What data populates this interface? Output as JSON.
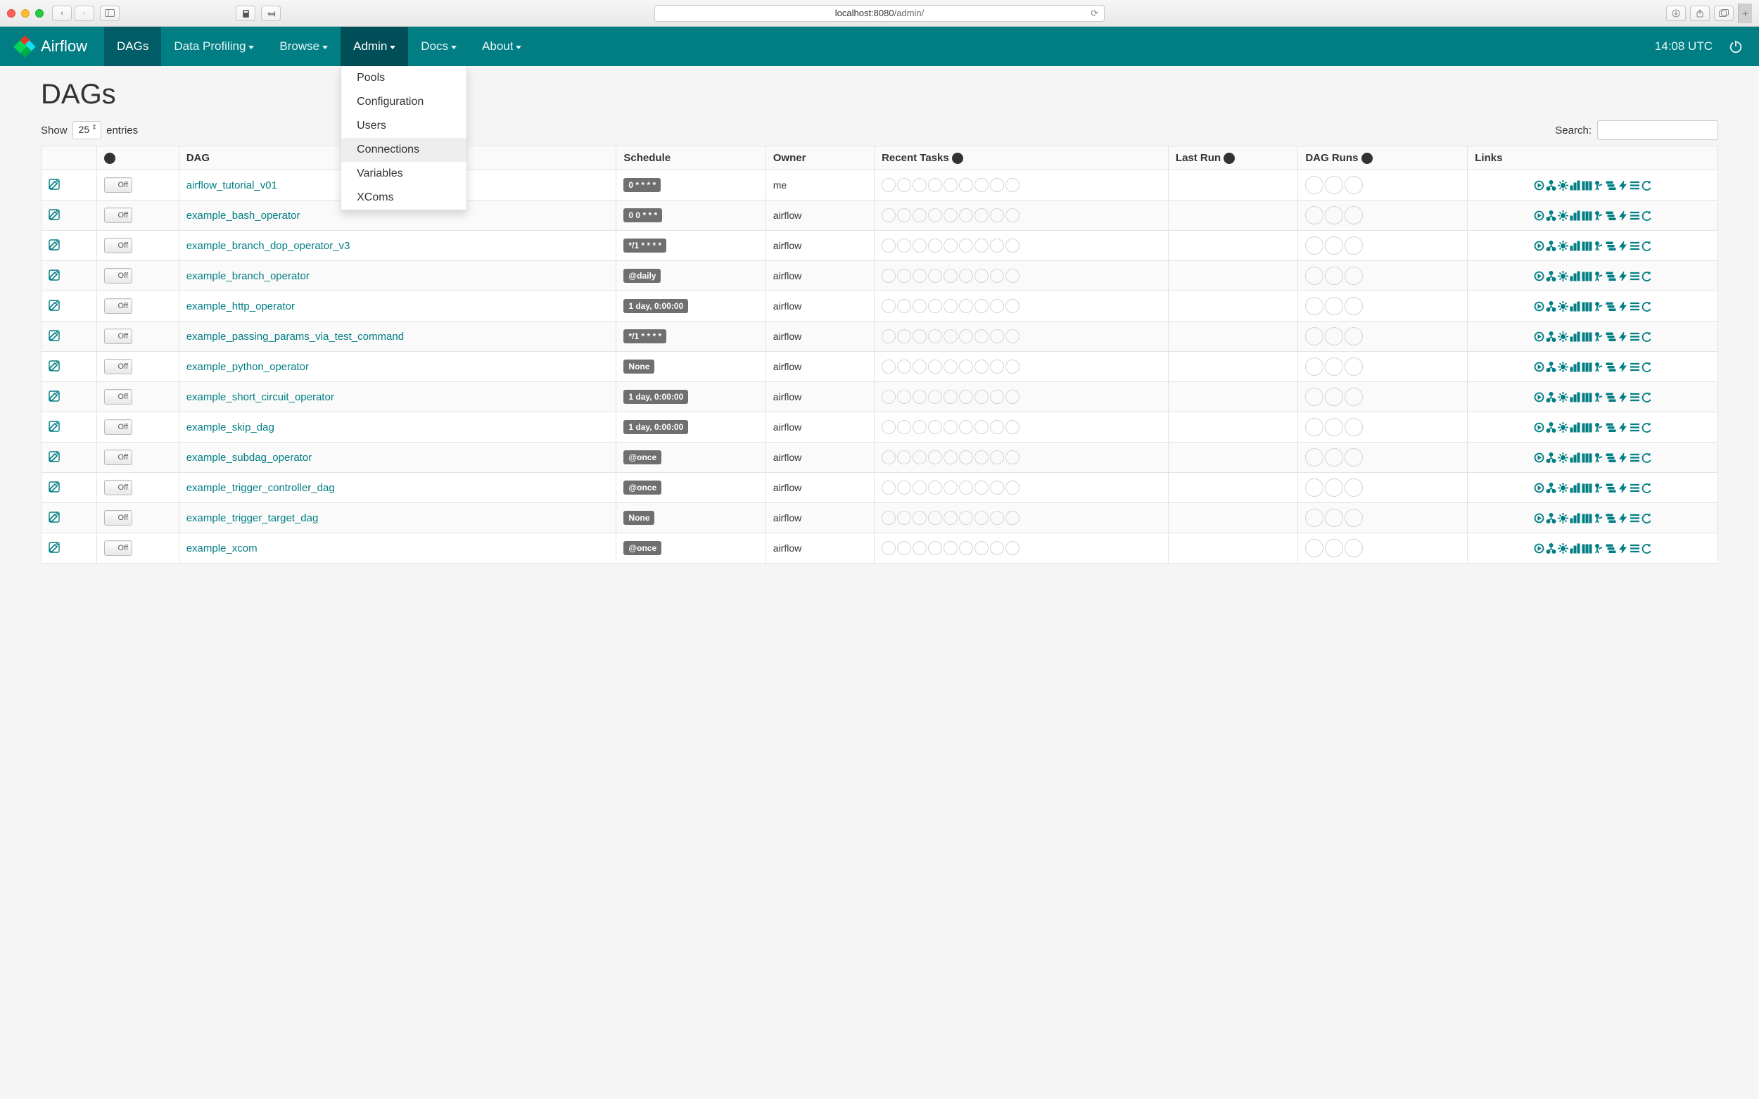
{
  "browser": {
    "url_host": "localhost:8080",
    "url_path": "/admin/"
  },
  "navbar": {
    "brand": "Airflow",
    "items": [
      {
        "label": "DAGs",
        "active": true
      },
      {
        "label": "Data Profiling",
        "dropdown": true
      },
      {
        "label": "Browse",
        "dropdown": true
      },
      {
        "label": "Admin",
        "dropdown": true,
        "open": true
      },
      {
        "label": "Docs",
        "dropdown": true
      },
      {
        "label": "About",
        "dropdown": true
      }
    ],
    "clock": "14:08 UTC",
    "admin_menu": [
      {
        "label": "Pools"
      },
      {
        "label": "Configuration"
      },
      {
        "label": "Users"
      },
      {
        "label": "Connections",
        "hover": true
      },
      {
        "label": "Variables"
      },
      {
        "label": "XComs"
      }
    ]
  },
  "page": {
    "title": "DAGs",
    "show_label": "Show",
    "entries_value": "25",
    "entries_label": "entries",
    "search_label": "Search:",
    "search_value": ""
  },
  "table": {
    "headers": {
      "dag": "DAG",
      "schedule": "Schedule",
      "owner": "Owner",
      "recent_tasks": "Recent Tasks",
      "last_run": "Last Run",
      "dag_runs": "DAG Runs",
      "links": "Links"
    },
    "toggle_label": "Off",
    "rows": [
      {
        "dag": "airflow_tutorial_v01",
        "schedule": "0 * * * *",
        "owner": "me"
      },
      {
        "dag": "example_bash_operator",
        "schedule": "0 0 * * *",
        "owner": "airflow"
      },
      {
        "dag": "example_branch_dop_operator_v3",
        "schedule": "*/1 * * * *",
        "owner": "airflow"
      },
      {
        "dag": "example_branch_operator",
        "schedule": "@daily",
        "owner": "airflow"
      },
      {
        "dag": "example_http_operator",
        "schedule": "1 day, 0:00:00",
        "owner": "airflow"
      },
      {
        "dag": "example_passing_params_via_test_command",
        "schedule": "*/1 * * * *",
        "owner": "airflow"
      },
      {
        "dag": "example_python_operator",
        "schedule": "None",
        "owner": "airflow"
      },
      {
        "dag": "example_short_circuit_operator",
        "schedule": "1 day, 0:00:00",
        "owner": "airflow"
      },
      {
        "dag": "example_skip_dag",
        "schedule": "1 day, 0:00:00",
        "owner": "airflow"
      },
      {
        "dag": "example_subdag_operator",
        "schedule": "@once",
        "owner": "airflow"
      },
      {
        "dag": "example_trigger_controller_dag",
        "schedule": "@once",
        "owner": "airflow"
      },
      {
        "dag": "example_trigger_target_dag",
        "schedule": "None",
        "owner": "airflow"
      },
      {
        "dag": "example_xcom",
        "schedule": "@once",
        "owner": "airflow"
      }
    ]
  }
}
